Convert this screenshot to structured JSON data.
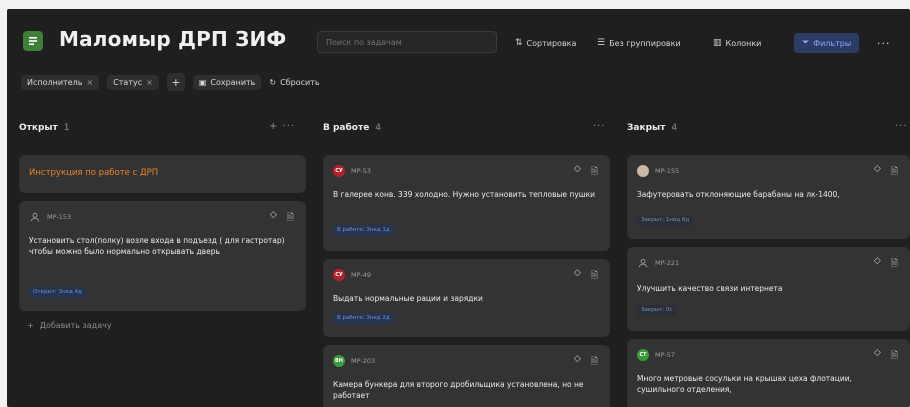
{
  "app": {
    "title": "Маломыр ДРП ЗИФ",
    "brand_color": "#3f7f3a"
  },
  "header": {
    "search_placeholder": "Поиск по задачам",
    "sort_label": "Сортировка",
    "group_label": "Без группировки",
    "columns_label": "Колонки",
    "filters_label": "Фильтры",
    "more_label": "···"
  },
  "filterbar": {
    "chips": [
      {
        "label": "Исполнитель",
        "close": "×"
      },
      {
        "label": "Статус",
        "close": "×"
      }
    ],
    "add_label": "+",
    "save_label": "Сохранить",
    "reset_label": "Сбросить"
  },
  "columns": [
    {
      "name": "Открыт",
      "count": "1",
      "actions": "+ ···",
      "instruction": "Инструкция по работе с ДРП",
      "cards": [
        {
          "id": "MP-153",
          "avatar": "user-icon",
          "text": "Установить стол(полку) возле входа в подъезд ( для гастротар) чтобы можно было нормально открывать дверь",
          "badge": "Открыт: 3нед 4д"
        }
      ],
      "add_task": "Добавить задачу"
    },
    {
      "name": "В работе",
      "count": "4",
      "actions": "···",
      "cards": [
        {
          "id": "MP-53",
          "avatar": "СУ",
          "text": "В галерее конв. 339 холодно. Нужно установить тепловые пушки",
          "badge": "В работе: 3нед 1д"
        },
        {
          "id": "MP-49",
          "avatar": "СУ",
          "text": "Выдать нормальные рации и зарядки",
          "badge": "В работе: 3нед 2д"
        },
        {
          "id": "MP-203",
          "avatar": "ВН",
          "text": "Камера бункера для второго дробильщика установлена, но не работает",
          "badge": ""
        }
      ]
    },
    {
      "name": "Закрыт",
      "count": "4",
      "actions": "···",
      "cards": [
        {
          "id": "MP-155",
          "avatar": "photo",
          "text": "Зафутеровать отклоняющие барабаны на лк-1400,",
          "badge": "Закрыт: 1нед 6д"
        },
        {
          "id": "MP-221",
          "avatar": "user-icon",
          "text": "Улучшить качество связи интернета",
          "badge": "Закрыт: 0с"
        },
        {
          "id": "MP-57",
          "avatar": "СТ",
          "text": "Много метровые сосульки на крышах цеха флотации, сушильного отделения,",
          "badge": ""
        }
      ]
    }
  ],
  "colors": {
    "background": "#1f1f1f",
    "card": "#333333",
    "accent_orange": "#e8842a",
    "filter_blue": "#8aa6ff"
  }
}
